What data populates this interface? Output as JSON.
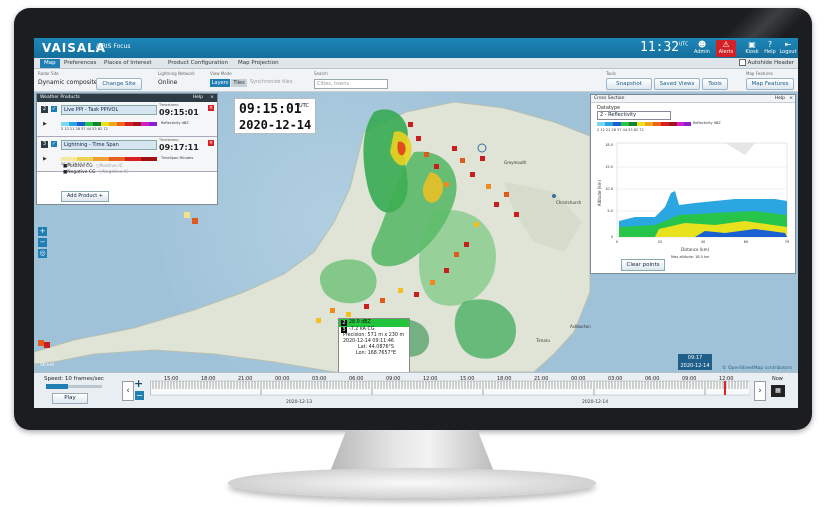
{
  "header": {
    "logo": "VAISALA",
    "app_name": "/ IRIS Focus",
    "clock": "11:32",
    "clock_suffix": "UTC",
    "buttons": [
      {
        "label": "Admin",
        "icon": "admin-icon"
      },
      {
        "label": "Alerts",
        "icon": "alert-icon"
      },
      {
        "label": "Kiosk",
        "icon": "monitor-icon"
      },
      {
        "label": "Help",
        "icon": "help-icon"
      },
      {
        "label": "Logout",
        "icon": "logout-icon"
      }
    ]
  },
  "tabs": [
    {
      "label": "Map",
      "active": true
    },
    {
      "label": "Preferences"
    },
    {
      "label": "Places of Interest"
    },
    {
      "label": "Product Configuration"
    },
    {
      "label": "Map Projection"
    }
  ],
  "autohide_label": "Autohide Header",
  "toolbar": {
    "radar_site_label": "Radar Site",
    "radar_site_value": "Dynamic composite",
    "change_site": "Change Site",
    "lightning_label": "Lightning Network",
    "lightning_value": "Online",
    "view_mode_label": "View Mode",
    "layers": "Layers",
    "tiles": "Tiles",
    "sync_tiles": "Synchronize tiles",
    "search_label": "Search",
    "search_placeholder": "Cities, towns",
    "tools_label": "Tools",
    "snapshot": "Snapshot",
    "saved_views": "Saved Views",
    "tools": "Tools",
    "map_features_label": "Map Features",
    "map_features": "Map Features"
  },
  "weather_products": {
    "title": "Weather Products",
    "help": "Help",
    "products": [
      {
        "num": "2",
        "name": "Live PPI - Task PPIVOL",
        "timestamp_label": "Timestamp",
        "time": "09:15:01",
        "scale_labels": "2   12   21   28   37   44   53   62   72",
        "unit": "Reflectivity dBZ"
      },
      {
        "num": "3",
        "name": "Lightning - Time Span",
        "timestamp_label": "Timestamp",
        "time": "09:17:11",
        "scale_labels": "20    30    15    10    5    0",
        "unit": "TimeSpan Minutes"
      }
    ],
    "legend": {
      "positive_cg": "Positive CG",
      "negative_cg": "Negative CG",
      "positive_ic": "Positive IC",
      "negative_ic": "Negative IC"
    },
    "add_product": "Add Product +"
  },
  "map_time": {
    "time": "09:15:01",
    "utc": "UTC",
    "date": "2020-12-14"
  },
  "cross_section": {
    "title": "Cross Section",
    "help": "Help",
    "datatype_label": "Datatype",
    "datatype_value": "2 - Reflectivity",
    "scale_labels": "2   12   21   28   37   44   53   62   72",
    "unit": "Reflectivity dBZ",
    "ylabel": "Altitude (km)",
    "xlabel": "Distance (km)",
    "yticks": [
      "0",
      "5.0",
      "10.0",
      "15.0",
      "18.0"
    ],
    "xticks": [
      "0",
      "20",
      "40",
      "60",
      "79"
    ],
    "clear_points": "Clear points",
    "max_altitude": "Max altitude: 18.0 km"
  },
  "tooltip": {
    "product_num": "2",
    "reflectivity": "28.0 dBZ",
    "lightning_num": "3",
    "lightning": "-7.2 kA CG",
    "precision": "Precision: 571 m x 230 m",
    "datetime": "2020-12-14 09:11:46",
    "lat": "Lat: 44.0876°S",
    "lon": "Lon: 168.7657°E"
  },
  "map": {
    "scale": "50 km",
    "attribution": "© OpenStreetMap contributors",
    "stamp_time": "09:17",
    "stamp_date": "2020-12-14",
    "cities": [
      "Greymouth",
      "Christchurch",
      "Ashburton",
      "Timaru"
    ]
  },
  "bottom": {
    "speed": "Speed: 10 frames/sec",
    "speed_fraction": 0.4,
    "play": "Play",
    "time_labels": [
      "15:00",
      "18:00",
      "21:00",
      "00:00",
      "03:00",
      "06:00",
      "09:00",
      "12:00",
      "15:00",
      "18:00",
      "21:00",
      "00:00",
      "03:00",
      "06:00",
      "09:00",
      "12:00"
    ],
    "dates": [
      "2020-12-13",
      "2020-12-14"
    ],
    "now": "Now"
  },
  "colors": {
    "header": "#1d87b9",
    "accent": "#1f7fb3",
    "alert": "#d42126"
  }
}
